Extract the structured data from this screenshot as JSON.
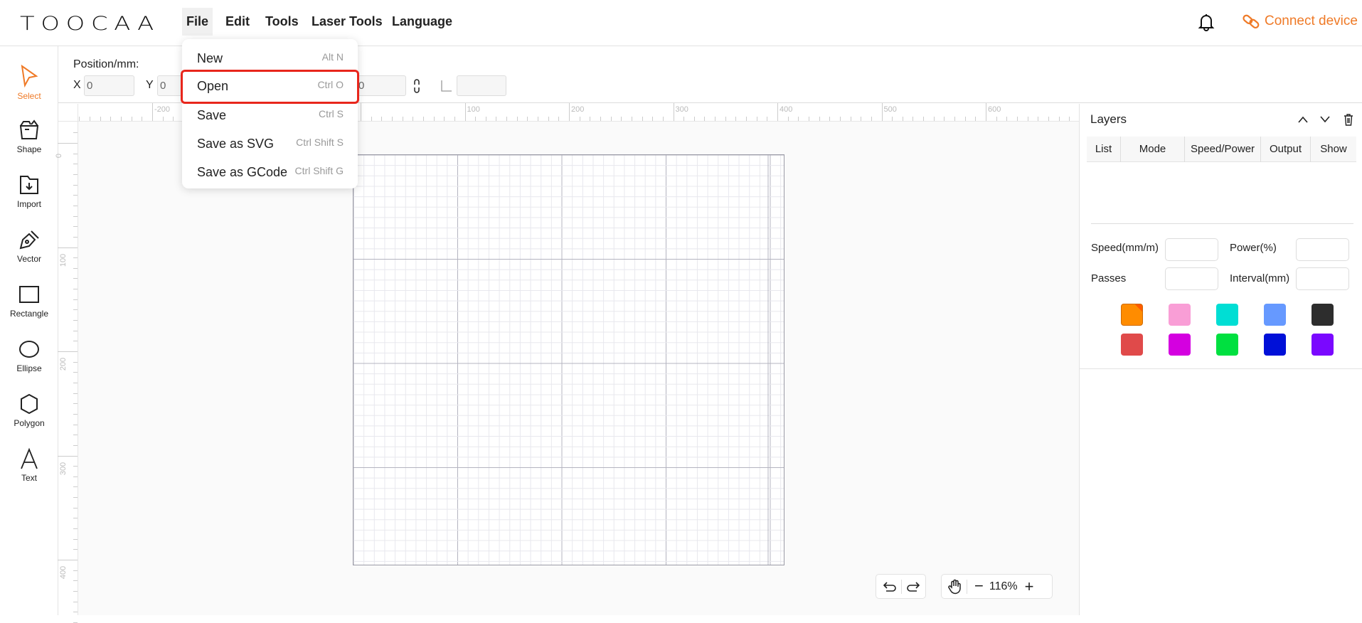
{
  "header": {
    "logo": "TOOCAA",
    "menus": [
      "File",
      "Edit",
      "Tools",
      "Laser Tools",
      "Language"
    ],
    "connect_label": "Connect device",
    "accent": "#ef7a27"
  },
  "sidebar": {
    "items": [
      {
        "label": "Select",
        "icon": "cursor-icon",
        "selected": true
      },
      {
        "label": "Shape",
        "icon": "shape-box-icon"
      },
      {
        "label": "Import",
        "icon": "import-folder-icon"
      },
      {
        "label": "Vector",
        "icon": "pen-icon"
      },
      {
        "label": "Rectangle",
        "icon": "rectangle-icon"
      },
      {
        "label": "Ellipse",
        "icon": "ellipse-icon"
      },
      {
        "label": "Polygon",
        "icon": "hexagon-icon"
      },
      {
        "label": "Text",
        "icon": "text-icon"
      }
    ]
  },
  "toolbar": {
    "position_label": "Position/mm:",
    "x_label": "X",
    "x_value": "0",
    "y_label": "Y",
    "y_value": "0",
    "w_value": "0",
    "angle_value": ""
  },
  "file_menu": {
    "items": [
      {
        "label": "New",
        "shortcut": "Alt N"
      },
      {
        "label": "Open",
        "shortcut": "Ctrl O",
        "highlighted": true
      },
      {
        "label": "Save",
        "shortcut": "Ctrl S"
      },
      {
        "label": "Save as SVG",
        "shortcut": "Ctrl Shift S"
      },
      {
        "label": "Save as GCode",
        "shortcut": "Ctrl Shift G"
      }
    ]
  },
  "ruler": {
    "x_labels": [
      "-200",
      "100",
      "200",
      "300",
      "400",
      "500",
      "600"
    ],
    "y_labels": [
      "0",
      "100",
      "200",
      "300",
      "400"
    ]
  },
  "layers": {
    "title": "Layers",
    "columns": [
      "List",
      "Mode",
      "Speed/Power",
      "Output",
      "Show"
    ],
    "speed_label": "Speed(mm/m)",
    "power_label": "Power(%)",
    "passes_label": "Passes",
    "interval_label": "Interval(mm)",
    "colors": [
      "#ff8c00",
      "#f99ed6",
      "#00ded4",
      "#6699ff",
      "#2d2d2d",
      "#e04a4a",
      "#d400e0",
      "#00e040",
      "#0010d8",
      "#7a08ff"
    ],
    "selected_color": "#ff8c00"
  },
  "zoom": {
    "level": "116%"
  }
}
